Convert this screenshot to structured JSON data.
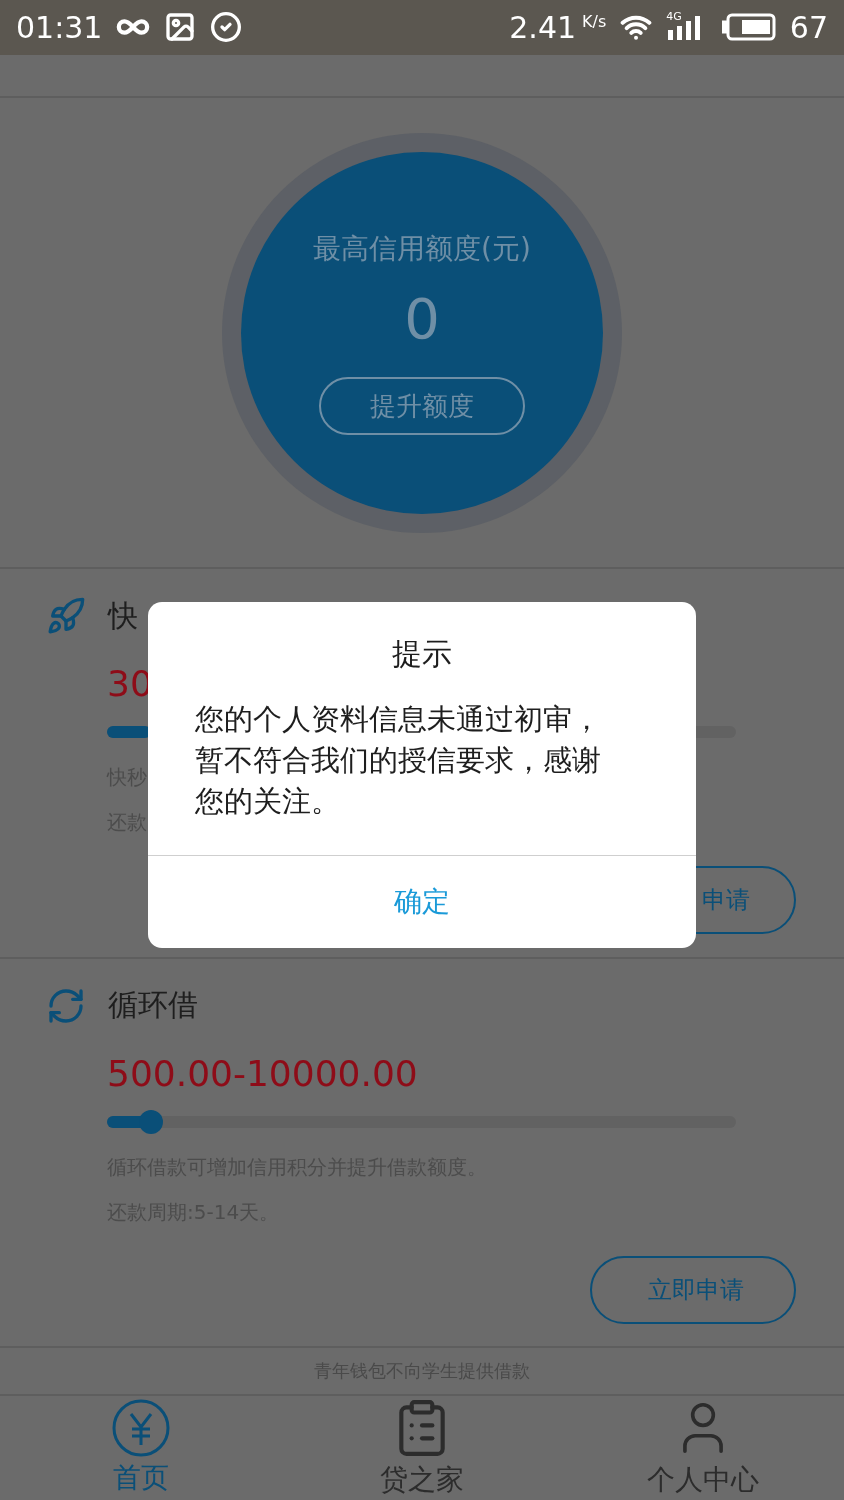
{
  "status_bar": {
    "time": "01:31",
    "speed": "2.41",
    "speed_unit": "K/s",
    "network": "4G",
    "battery": "67"
  },
  "credit": {
    "title": "最高信用额度(元)",
    "amount": "0",
    "button": "提升额度"
  },
  "products": [
    {
      "kind": "rocket",
      "title": "快",
      "amount": "30",
      "level": 0.07,
      "lines": [
        "快秒",
        "还款"
      ],
      "button": "申请",
      "covered": true
    },
    {
      "kind": "cycle",
      "title": "循环借",
      "amount": "500.00-10000.00",
      "level": 0.07,
      "lines": [
        "循环借款可增加信用积分并提升借款额度。",
        "还款周期:5-14天。"
      ],
      "button": "立即申请",
      "covered": false
    }
  ],
  "notice": "青年钱包不向学生提供借款",
  "tabs": [
    {
      "label": "首页",
      "kind": "home",
      "selected": true
    },
    {
      "label": "贷之家",
      "kind": "clipboard",
      "selected": false
    },
    {
      "label": "个人中心",
      "kind": "person",
      "selected": false
    }
  ],
  "dialog": {
    "title": "提示",
    "message": "您的个人资料信息未通过初审，暂不符合我们的授信要求，感谢您的关注。",
    "confirm": "确定"
  }
}
